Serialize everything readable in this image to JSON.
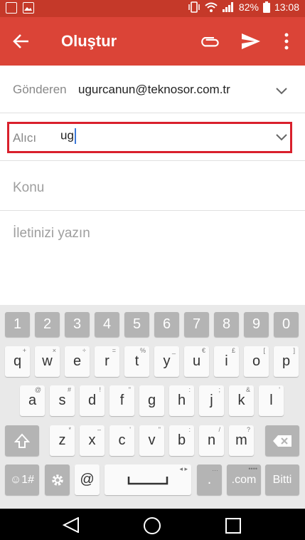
{
  "status_bar": {
    "battery": "82%",
    "time": "13:08"
  },
  "app_bar": {
    "title": "Oluştur"
  },
  "compose": {
    "from_label": "Gönderen",
    "from_value": "ugurcanun@teknosor.com.tr",
    "to_label": "Alıcı",
    "to_value": "ug",
    "subject_placeholder": "Konu",
    "body_placeholder": "İletinizi yazın"
  },
  "keyboard": {
    "number_row": [
      "1",
      "2",
      "3",
      "4",
      "5",
      "6",
      "7",
      "8",
      "9",
      "0"
    ],
    "row1": [
      "q",
      "w",
      "e",
      "r",
      "t",
      "y",
      "u",
      "i",
      "o",
      "p"
    ],
    "row1_hints": [
      "+",
      "×",
      "÷",
      "=",
      "%",
      "_",
      "€",
      "£",
      "[",
      "]"
    ],
    "row2": [
      "a",
      "s",
      "d",
      "f",
      "g",
      "h",
      "j",
      "k",
      "l"
    ],
    "row2_hints": [
      "@",
      "#",
      "!",
      "\"",
      "",
      ":",
      ";",
      "&",
      "'"
    ],
    "row3": [
      "z",
      "x",
      "c",
      "v",
      "b",
      "n",
      "m"
    ],
    "row3_hints": [
      "*",
      "–",
      "'",
      "\"",
      ":",
      "/",
      "?"
    ],
    "sym_label": "☺1#",
    "at_label": "@",
    "period_label": ".",
    "dotcom_label": ".com",
    "done_label": "Bitti",
    "dotcom_hint": "••••"
  },
  "colors": {
    "app_bar": "#db4437",
    "status_bar": "#c53929",
    "highlight": "#d9202c",
    "caret": "#3c78d8"
  }
}
